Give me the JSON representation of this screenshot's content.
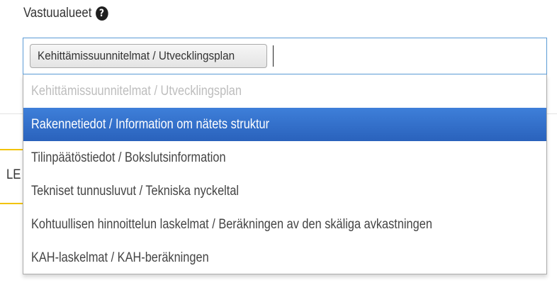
{
  "field": {
    "label": "Vastuualueet",
    "help_icon": "question-circle-icon"
  },
  "selected_chips": [
    {
      "label": "Kehittämissuunnitelmat / Utvecklingsplan"
    }
  ],
  "search": {
    "value": ""
  },
  "options": [
    {
      "label": "Kehittämissuunnitelmat / Utvecklingsplan",
      "state": "disabled"
    },
    {
      "label": "Rakennetiedot / Information om nätets struktur",
      "state": "highlighted"
    },
    {
      "label": "Tilinpäätöstiedot / Bokslutsinformation",
      "state": "normal"
    },
    {
      "label": "Tekniset tunnusluvut / Tekniska nyckeltal",
      "state": "normal"
    },
    {
      "label": "Kohtuullisen hinnoittelun laskelmat / Beräkningen av den skäliga avkastningen",
      "state": "normal"
    },
    {
      "label": "KAH-laskelmat / KAH-beräkningen",
      "state": "normal"
    }
  ],
  "background": {
    "fragment_text": "LE"
  },
  "colors": {
    "highlight": "#3875d7",
    "focus_border": "#5b9bd5",
    "accent_yellow": "#f2c300"
  }
}
